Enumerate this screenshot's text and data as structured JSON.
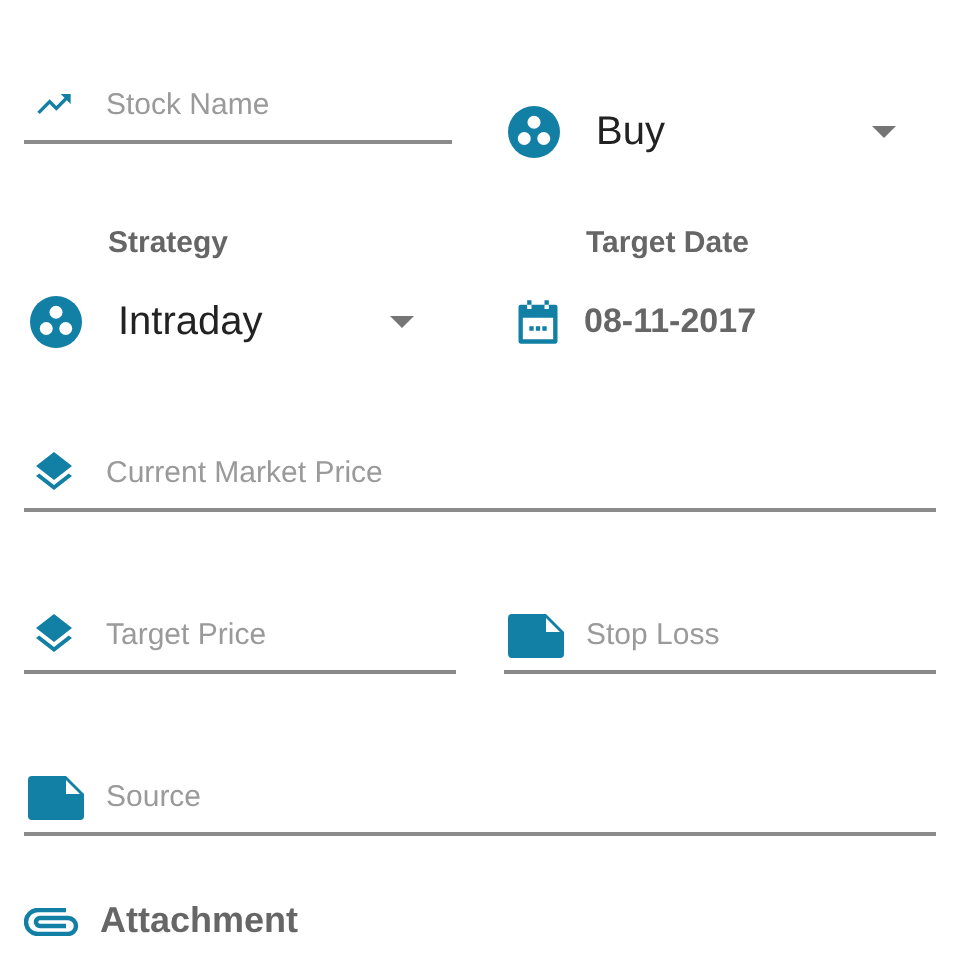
{
  "stock_name": {
    "placeholder": "Stock Name"
  },
  "side_select": {
    "value": "Buy"
  },
  "strategy": {
    "label": "Strategy",
    "value": "Intraday"
  },
  "target_date": {
    "label": "Target Date",
    "value": "08-11-2017"
  },
  "current_market_price": {
    "placeholder": "Current Market Price"
  },
  "target_price": {
    "placeholder": "Target Price"
  },
  "stop_loss": {
    "placeholder": "Stop Loss"
  },
  "source": {
    "placeholder": "Source"
  },
  "attachment": {
    "label": "Attachment"
  }
}
